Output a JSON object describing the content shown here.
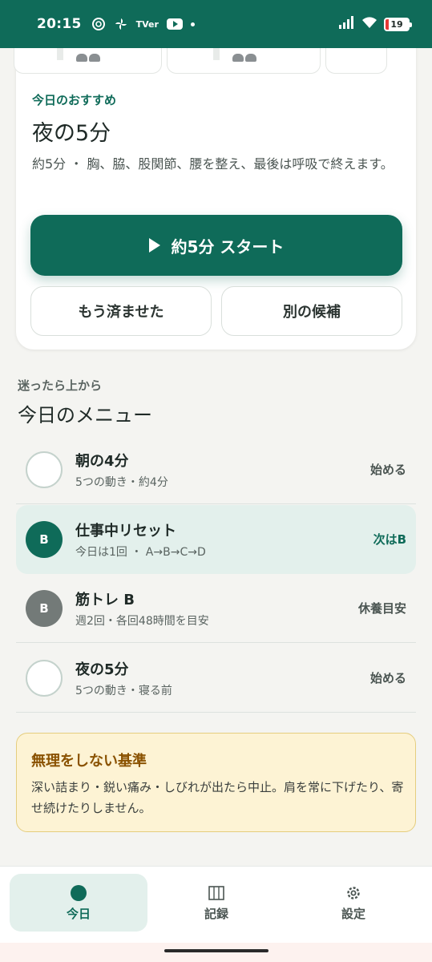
{
  "status_bar": {
    "time": "20:15",
    "icons": [
      "openai-icon",
      "pinwheel-icon",
      "tver-icon",
      "youtube-icon",
      "dot-icon"
    ],
    "tver_label": "TVer",
    "battery": "19"
  },
  "recommendation": {
    "label": "今日のおすすめ",
    "title": "夜の5分",
    "description": "約5分 ・ 胸、脇、股関節、腰を整え、最後は呼吸で終えます。",
    "start_button": "約5分 スタート",
    "done_button": "もう済ませた",
    "alt_button": "別の候補"
  },
  "menu": {
    "subtitle": "迷ったら上から",
    "title": "今日のメニュー",
    "items": [
      {
        "badge": "",
        "title": "朝の4分",
        "subtitle": "5つの動き・約4分",
        "action": "始める"
      },
      {
        "badge": "B",
        "title": "仕事中リセット",
        "subtitle": "今日は1回 ・ A→B→C→D",
        "action": "次はB"
      },
      {
        "badge": "B",
        "title": "筋トレ B",
        "subtitle": "週2回・各回48時間を目安",
        "action": "休養目安"
      },
      {
        "badge": "",
        "title": "夜の5分",
        "subtitle": "5つの動き・寝る前",
        "action": "始める"
      }
    ]
  },
  "notice": {
    "title": "無理をしない基準",
    "text": "深い詰まり・鋭い痛み・しびれが出たら中止。肩を常に下げたり、寄せ続けたりしません。"
  },
  "bottom_nav": {
    "items": [
      {
        "label": "今日",
        "icon": "dot-icon"
      },
      {
        "label": "記録",
        "icon": "columns-icon"
      },
      {
        "label": "設定",
        "icon": "gear-icon"
      }
    ]
  },
  "colors": {
    "primary": "#0f6b59",
    "active_bg": "#e3f0ec",
    "notice_bg": "#fdf3d4",
    "notice_title": "#8a5200"
  }
}
